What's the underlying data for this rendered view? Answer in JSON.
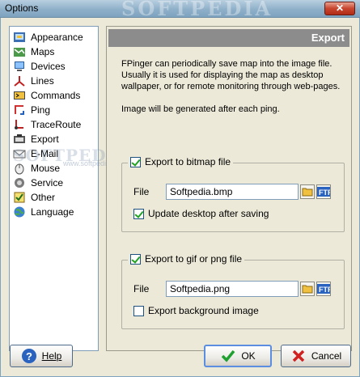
{
  "window": {
    "title": "Options",
    "watermark": "SOFTPEDIA",
    "close_label": "✕"
  },
  "sidebar": {
    "watermark": "SOFTPEDIA",
    "watermark_sub": "www.softpedia.com",
    "items": [
      {
        "label": "Appearance",
        "icon": "appearance-icon"
      },
      {
        "label": "Maps",
        "icon": "maps-icon"
      },
      {
        "label": "Devices",
        "icon": "devices-icon"
      },
      {
        "label": "Lines",
        "icon": "lines-icon"
      },
      {
        "label": "Commands",
        "icon": "commands-icon"
      },
      {
        "label": "Ping",
        "icon": "ping-icon"
      },
      {
        "label": "TraceRoute",
        "icon": "traceroute-icon"
      },
      {
        "label": "Export",
        "icon": "export-icon"
      },
      {
        "label": "E-Mail",
        "icon": "email-icon"
      },
      {
        "label": "Mouse",
        "icon": "mouse-icon"
      },
      {
        "label": "Service",
        "icon": "service-icon"
      },
      {
        "label": "Other",
        "icon": "other-icon"
      },
      {
        "label": "Language",
        "icon": "language-icon"
      }
    ]
  },
  "panel": {
    "header": "Export",
    "description_1": "FPinger can periodically save map into the image file.",
    "description_2": "Usually it is used for displaying the map as desktop",
    "description_3": "wallpaper, or for remote monitoring through web-pages.",
    "description_4": "Image will be generated after each ping.",
    "bitmap_group": {
      "title": "Export to bitmap file",
      "checked": true,
      "file_label": "File",
      "file_value": "Softpedia.bmp",
      "update_label": "Update desktop after saving",
      "update_checked": true
    },
    "gif_group": {
      "title": "Export to gif or png file",
      "checked": true,
      "file_label": "File",
      "file_value": "Softpedia.png",
      "background_label": "Export background image",
      "background_checked": false
    }
  },
  "buttons": {
    "help": "Help",
    "ok": "OK",
    "cancel": "Cancel"
  },
  "colors": {
    "accent": "#5b8de0",
    "header_bg": "#8c8c8c"
  }
}
